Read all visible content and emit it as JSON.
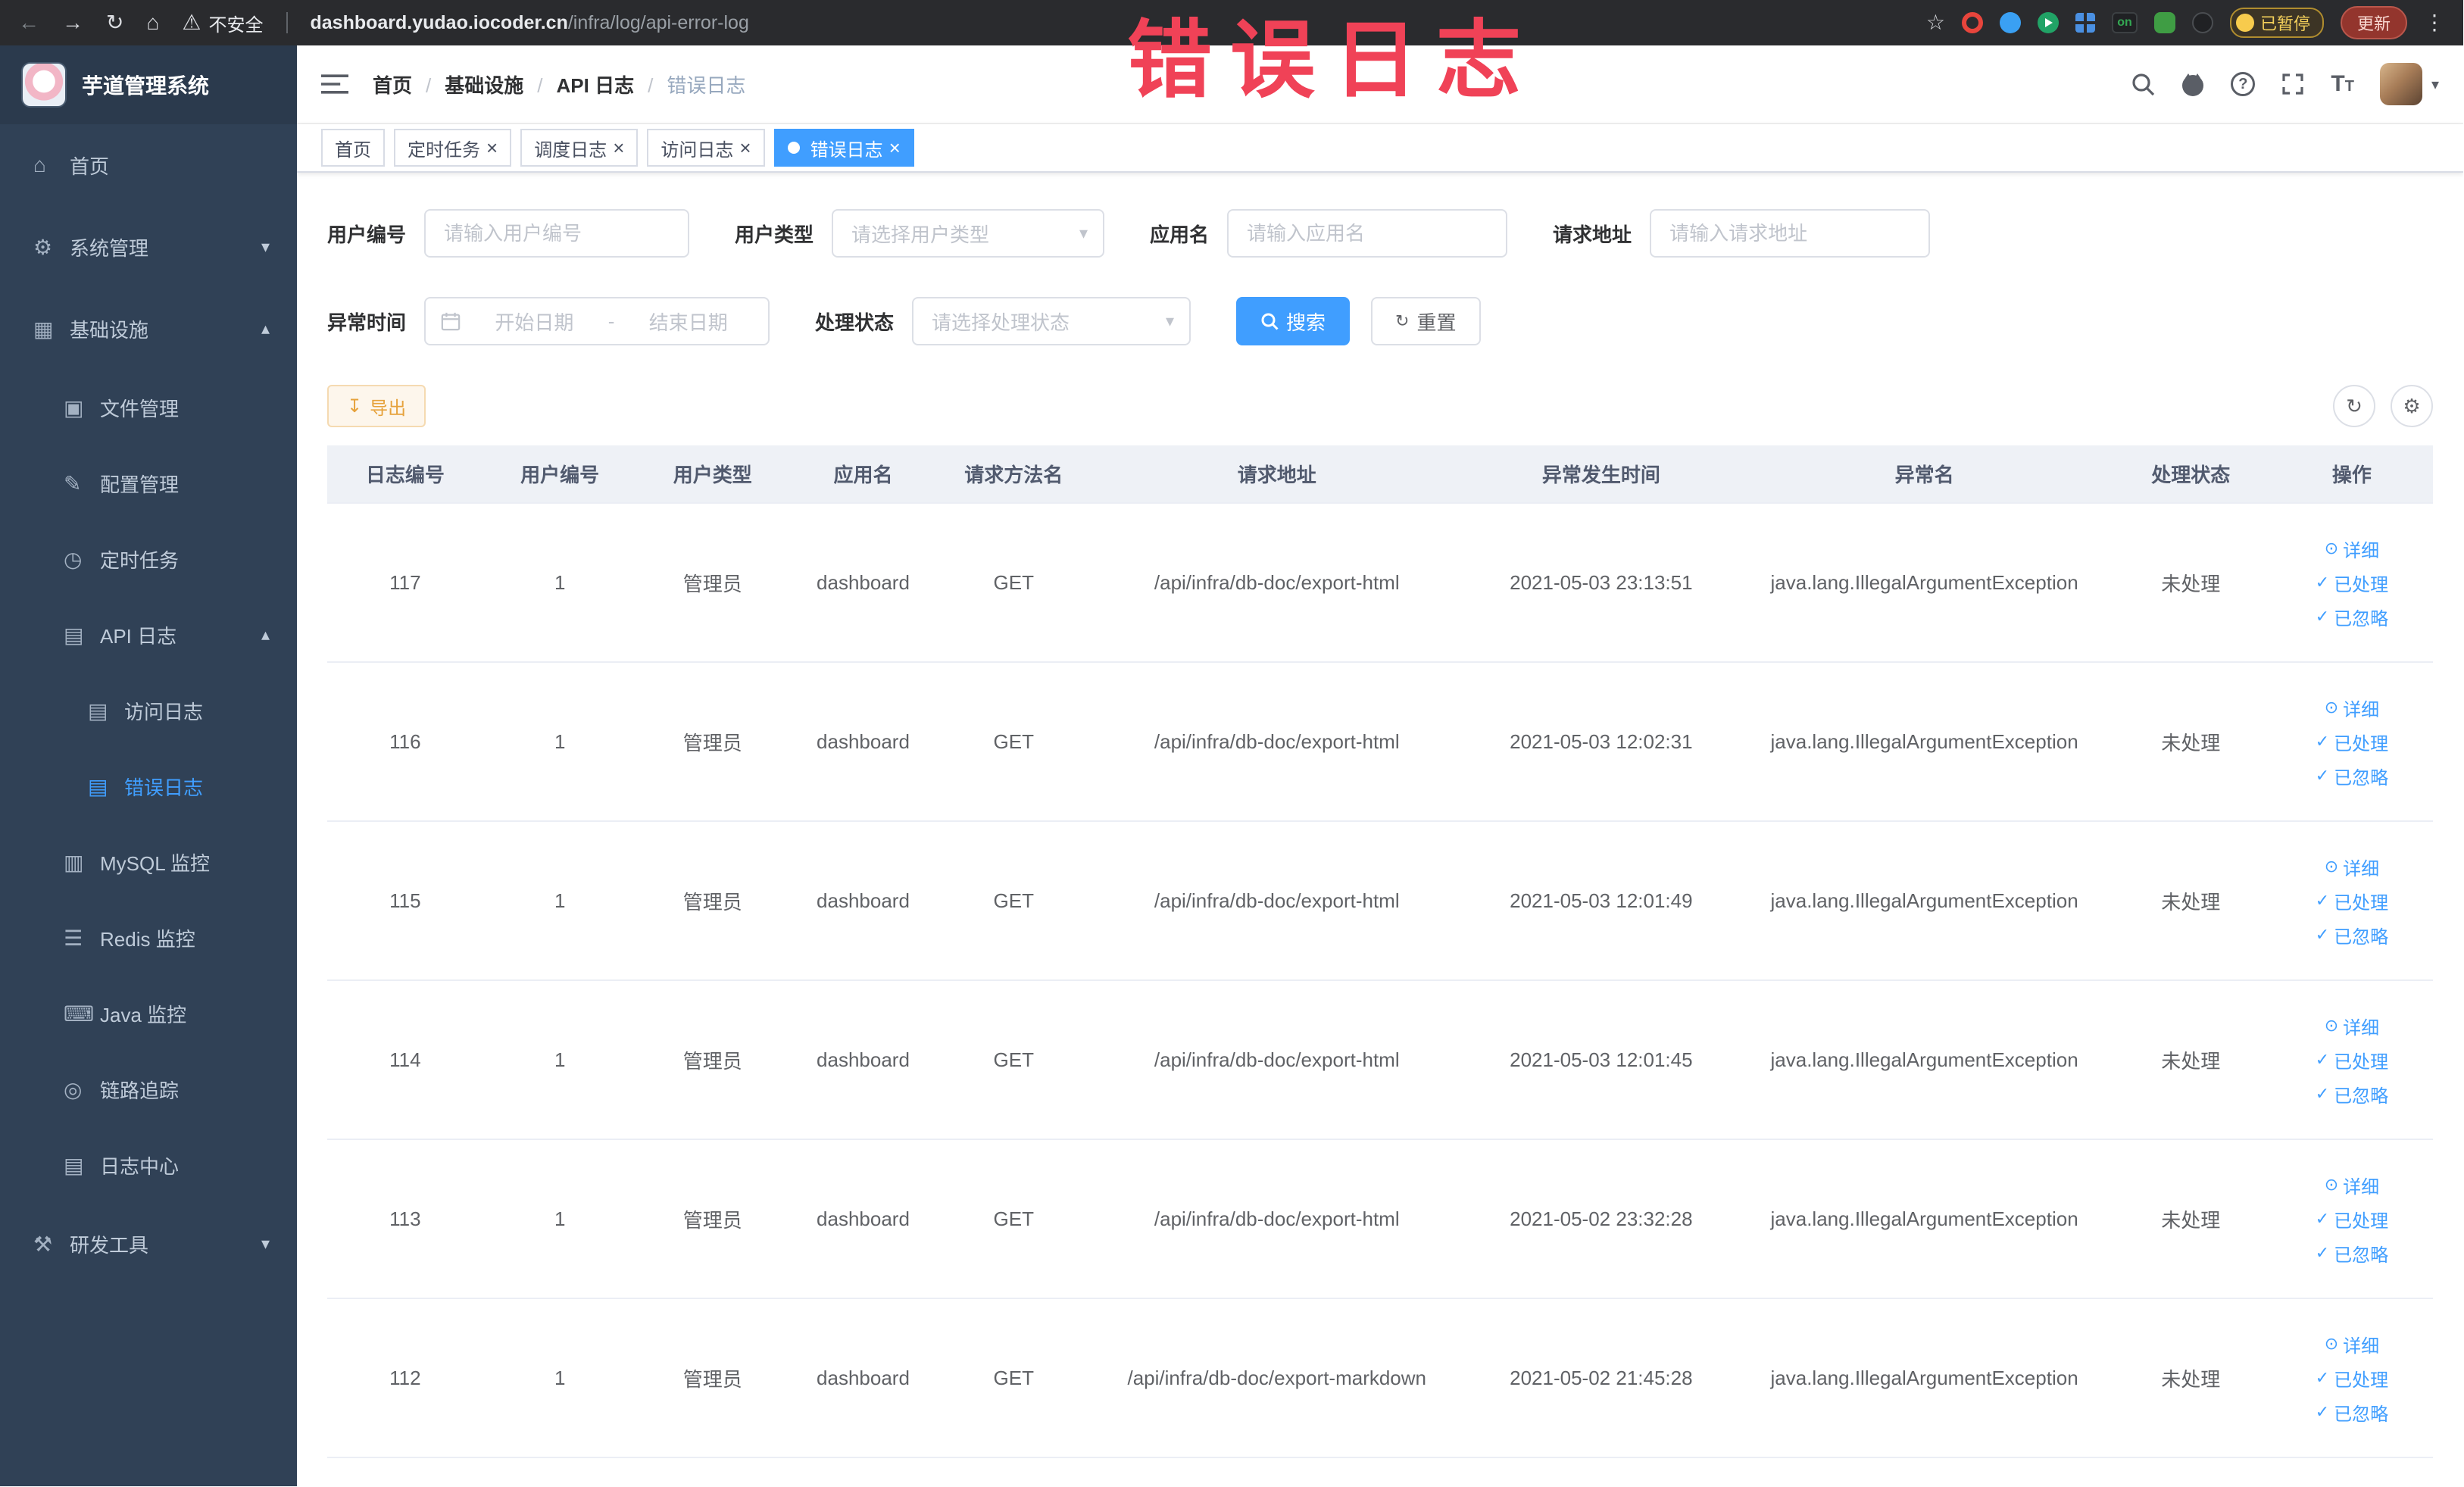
{
  "icons": {
    "back": "←",
    "forward": "→",
    "reload": "↻",
    "home": "⌂",
    "warning": "⚠",
    "star": "☆",
    "menu_dots": "⋮",
    "caret_down": "▾",
    "close": "×",
    "question": "?",
    "font_size": "T",
    "refresh": "↻",
    "gear": "⚙",
    "download": "↧",
    "eye": "⊙",
    "check": "✓",
    "select_caret": "▾"
  },
  "browser": {
    "security_label": "不安全",
    "url_domain": "dashboard.yudao.iocoder.cn",
    "url_path": "/infra/log/api-error-log",
    "ext_on": "on",
    "paused_badge": "已暂停",
    "update_button": "更新"
  },
  "annotation": {
    "text": "错误日志"
  },
  "sidebar": {
    "logo_title": "芋道管理系统",
    "items": [
      {
        "label": "首页",
        "icon": "⌂"
      },
      {
        "label": "系统管理",
        "icon": "⚙",
        "chevron": "▾"
      },
      {
        "label": "基础设施",
        "icon": "▦",
        "chevron": "▴"
      },
      {
        "label": "文件管理",
        "icon": "▣"
      },
      {
        "label": "配置管理",
        "icon": "✎"
      },
      {
        "label": "定时任务",
        "icon": "◷"
      },
      {
        "label": "API 日志",
        "icon": "▤",
        "chevron": "▴"
      },
      {
        "label": "访问日志",
        "icon": "▤"
      },
      {
        "label": "错误日志",
        "icon": "▤"
      },
      {
        "label": "MySQL 监控",
        "icon": "▥"
      },
      {
        "label": "Redis 监控",
        "icon": "☰"
      },
      {
        "label": "Java 监控",
        "icon": "⌨"
      },
      {
        "label": "链路追踪",
        "icon": "◎"
      },
      {
        "label": "日志中心",
        "icon": "▤"
      },
      {
        "label": "研发工具",
        "icon": "⚒",
        "chevron": "▾"
      }
    ]
  },
  "breadcrumb": [
    "首页",
    "基础设施",
    "API 日志",
    "错误日志"
  ],
  "tabs": [
    {
      "label": "首页"
    },
    {
      "label": "定时任务"
    },
    {
      "label": "调度日志"
    },
    {
      "label": "访问日志"
    },
    {
      "label": "错误日志"
    }
  ],
  "filters": {
    "user_id_label": "用户编号",
    "user_id_placeholder": "请输入用户编号",
    "user_type_label": "用户类型",
    "user_type_placeholder": "请选择用户类型",
    "app_name_label": "应用名",
    "app_name_placeholder": "请输入应用名",
    "request_url_label": "请求地址",
    "request_url_placeholder": "请输入请求地址",
    "exception_time_label": "异常时间",
    "date_start_placeholder": "开始日期",
    "date_separator": "-",
    "date_end_placeholder": "结束日期",
    "process_status_label": "处理状态",
    "process_status_placeholder": "请选择处理状态",
    "search_label": "搜索",
    "reset_label": "重置"
  },
  "toolbar": {
    "export_label": "导出"
  },
  "table": {
    "columns": [
      "日志编号",
      "用户编号",
      "用户类型",
      "应用名",
      "请求方法名",
      "请求地址",
      "异常发生时间",
      "异常名",
      "处理状态",
      "操作"
    ],
    "actions": {
      "detail": "详细",
      "processed": "已处理",
      "ignored": "已忽略"
    },
    "rows": [
      {
        "log_id": "117",
        "user_id": "1",
        "user_type": "管理员",
        "app": "dashboard",
        "method": "GET",
        "url": "/api/infra/db-doc/export-html",
        "time": "2021-05-03 23:13:51",
        "exception": "java.lang.IllegalArgumentException",
        "status": "未处理"
      },
      {
        "log_id": "116",
        "user_id": "1",
        "user_type": "管理员",
        "app": "dashboard",
        "method": "GET",
        "url": "/api/infra/db-doc/export-html",
        "time": "2021-05-03 12:02:31",
        "exception": "java.lang.IllegalArgumentException",
        "status": "未处理"
      },
      {
        "log_id": "115",
        "user_id": "1",
        "user_type": "管理员",
        "app": "dashboard",
        "method": "GET",
        "url": "/api/infra/db-doc/export-html",
        "time": "2021-05-03 12:01:49",
        "exception": "java.lang.IllegalArgumentException",
        "status": "未处理"
      },
      {
        "log_id": "114",
        "user_id": "1",
        "user_type": "管理员",
        "app": "dashboard",
        "method": "GET",
        "url": "/api/infra/db-doc/export-html",
        "time": "2021-05-03 12:01:45",
        "exception": "java.lang.IllegalArgumentException",
        "status": "未处理"
      },
      {
        "log_id": "113",
        "user_id": "1",
        "user_type": "管理员",
        "app": "dashboard",
        "method": "GET",
        "url": "/api/infra/db-doc/export-html",
        "time": "2021-05-02 23:32:28",
        "exception": "java.lang.IllegalArgumentException",
        "status": "未处理"
      },
      {
        "log_id": "112",
        "user_id": "1",
        "user_type": "管理员",
        "app": "dashboard",
        "method": "GET",
        "url": "/api/infra/db-doc/export-markdown",
        "time": "2021-05-02 21:45:28",
        "exception": "java.lang.IllegalArgumentException",
        "status": "未处理"
      }
    ]
  }
}
